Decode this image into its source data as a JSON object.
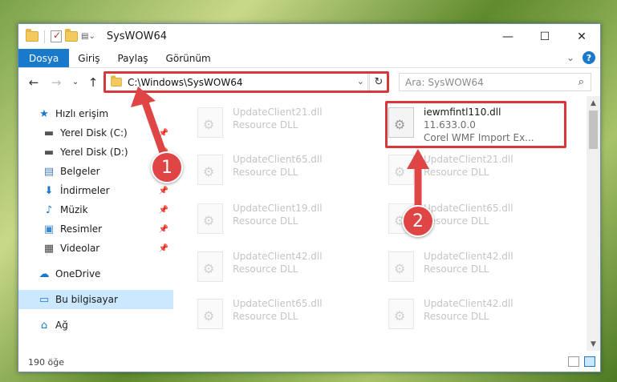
{
  "window": {
    "title": "SysWOW64",
    "minimize": "—",
    "maximize": "☐",
    "close": "✕"
  },
  "ribbon": {
    "tabs": [
      {
        "label": "Dosya",
        "active": true
      },
      {
        "label": "Giriş"
      },
      {
        "label": "Paylaş"
      },
      {
        "label": "Görünüm"
      }
    ],
    "expand": "⌄",
    "help": "?"
  },
  "nav": {
    "back": "←",
    "forward": "→",
    "recent": "⌄",
    "up": "↑",
    "address": "C:\\Windows\\SysWOW64",
    "address_drop": "⌄",
    "refresh": "↻",
    "search_placeholder": "Ara: SysWOW64",
    "search_icon": "⌕"
  },
  "sidebar": {
    "items": [
      {
        "label": "Hızlı erişim",
        "icon": "star-icon",
        "glyph": "★",
        "pinned": false
      },
      {
        "label": "Yerel Disk (C:)",
        "icon": "drive-icon",
        "glyph": "▬",
        "pinned": true
      },
      {
        "label": "Yerel Disk (D:)",
        "icon": "drive-icon",
        "glyph": "▬",
        "pinned": true
      },
      {
        "label": "Belgeler",
        "icon": "documents-icon",
        "glyph": "▤",
        "pinned": true
      },
      {
        "label": "İndirmeler",
        "icon": "download-icon",
        "glyph": "⬇",
        "pinned": true
      },
      {
        "label": "Müzik",
        "icon": "music-icon",
        "glyph": "♪",
        "pinned": true
      },
      {
        "label": "Resimler",
        "icon": "pictures-icon",
        "glyph": "▣",
        "pinned": true
      },
      {
        "label": "Videolar",
        "icon": "video-icon",
        "glyph": "▦",
        "pinned": true
      },
      {
        "label": "OneDrive",
        "icon": "cloud-icon",
        "glyph": "☁",
        "pinned": false
      },
      {
        "label": "Bu bilgisayar",
        "icon": "computer-icon",
        "glyph": "▭",
        "pinned": false,
        "selected": true
      },
      {
        "label": "Ağ",
        "icon": "network-icon",
        "glyph": "⌂",
        "pinned": false
      }
    ],
    "pin_glyph": "📌"
  },
  "files": [
    {
      "name": "UpdateClient21.dll",
      "sub": "Resource DLL",
      "faded": true
    },
    {
      "name": "iewmfintl110.dll",
      "sub": "11.633.0.0",
      "sub2": "Corel WMF Import Ex...",
      "faded": false
    },
    {
      "name": "UpdateClient65.dll",
      "sub": "Resource DLL",
      "faded": true
    },
    {
      "name": "UpdateClient21.dll",
      "sub": "Resource DLL",
      "faded": true
    },
    {
      "name": "UpdateClient19.dll",
      "sub": "Resource DLL",
      "faded": true
    },
    {
      "name": "UpdateClient65.dll",
      "sub": "Resource DLL",
      "faded": true
    },
    {
      "name": "UpdateClient42.dll",
      "sub": "Resource DLL",
      "faded": true
    },
    {
      "name": "UpdateClient42.dll",
      "sub": "Resource DLL",
      "faded": true
    },
    {
      "name": "UpdateClient65.dll",
      "sub": "Resource DLL",
      "faded": true
    },
    {
      "name": "UpdateClient42.dll",
      "sub": "Resource DLL",
      "faded": true
    }
  ],
  "status": {
    "count": "190 öğe"
  },
  "annotations": {
    "badge1": "1",
    "badge2": "2",
    "color": "#d9383a"
  }
}
